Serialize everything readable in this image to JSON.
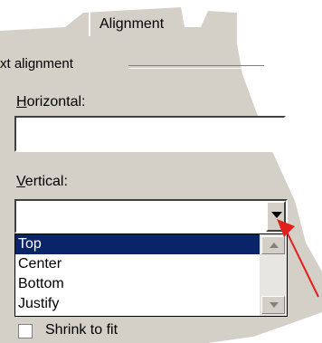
{
  "tab": {
    "title": "Alignment"
  },
  "text_alignment": {
    "group_label": "xt alignment",
    "horizontal": {
      "label_accel": "H",
      "label_rest": "orizontal:",
      "value": ""
    },
    "vertical": {
      "label_accel": "V",
      "label_rest": "ertical:",
      "value": "",
      "options": [
        "Top",
        "Center",
        "Bottom",
        "Justify"
      ],
      "selected_index": 0
    }
  },
  "shrink_to_fit": {
    "label": "Shrink to fit",
    "checked": false
  },
  "icons": {
    "dropdown": "chevron-down-icon",
    "scroll_up": "scroll-up-icon",
    "scroll_down": "scroll-down-icon",
    "annotation": "red-arrow-icon"
  },
  "colors": {
    "selection": "#0a246a",
    "annotation_arrow": "#e0201c",
    "dialog_bg": "#d4d0c8"
  }
}
